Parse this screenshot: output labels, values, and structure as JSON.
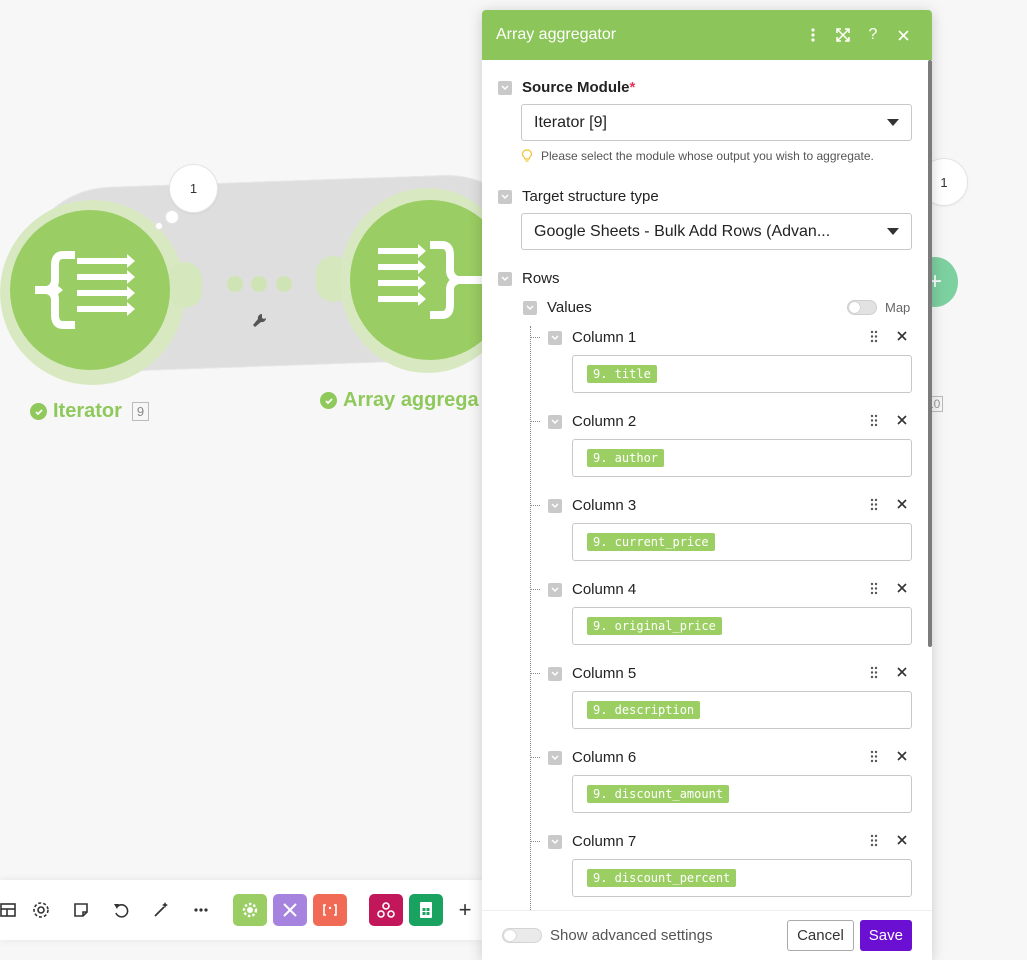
{
  "canvas": {
    "iterator": {
      "label": "Iterator",
      "count": "9",
      "bubble": "1"
    },
    "aggregator": {
      "label": "Array aggrega"
    },
    "right_module": {
      "bubble": "1",
      "count": "10"
    }
  },
  "panel": {
    "title": "Array aggregator",
    "source_module": {
      "label": "Source Module",
      "required_mark": "*",
      "value": "Iterator [9]",
      "hint": "Please select the module whose output you wish to aggregate."
    },
    "target_structure": {
      "label": "Target structure type",
      "value": "Google Sheets - Bulk Add Rows (Advan..."
    },
    "rows": {
      "label": "Rows"
    },
    "values": {
      "label": "Values",
      "map_label": "Map"
    },
    "columns": [
      {
        "label": "Column 1",
        "pill": "9. title"
      },
      {
        "label": "Column 2",
        "pill": "9. author"
      },
      {
        "label": "Column 3",
        "pill": "9. current_price"
      },
      {
        "label": "Column 4",
        "pill": "9. original_price"
      },
      {
        "label": "Column 5",
        "pill": "9. description"
      },
      {
        "label": "Column 6",
        "pill": "9. discount_amount"
      },
      {
        "label": "Column 7",
        "pill": "9. discount_percent"
      }
    ],
    "footer": {
      "advanced_label": "Show advanced settings",
      "cancel": "Cancel",
      "save": "Save"
    }
  },
  "colors": {
    "module_green": "#9acd63",
    "header_green": "#8cc55a",
    "pill_green": "#9ccf63",
    "save_purple": "#6b0fd2"
  }
}
